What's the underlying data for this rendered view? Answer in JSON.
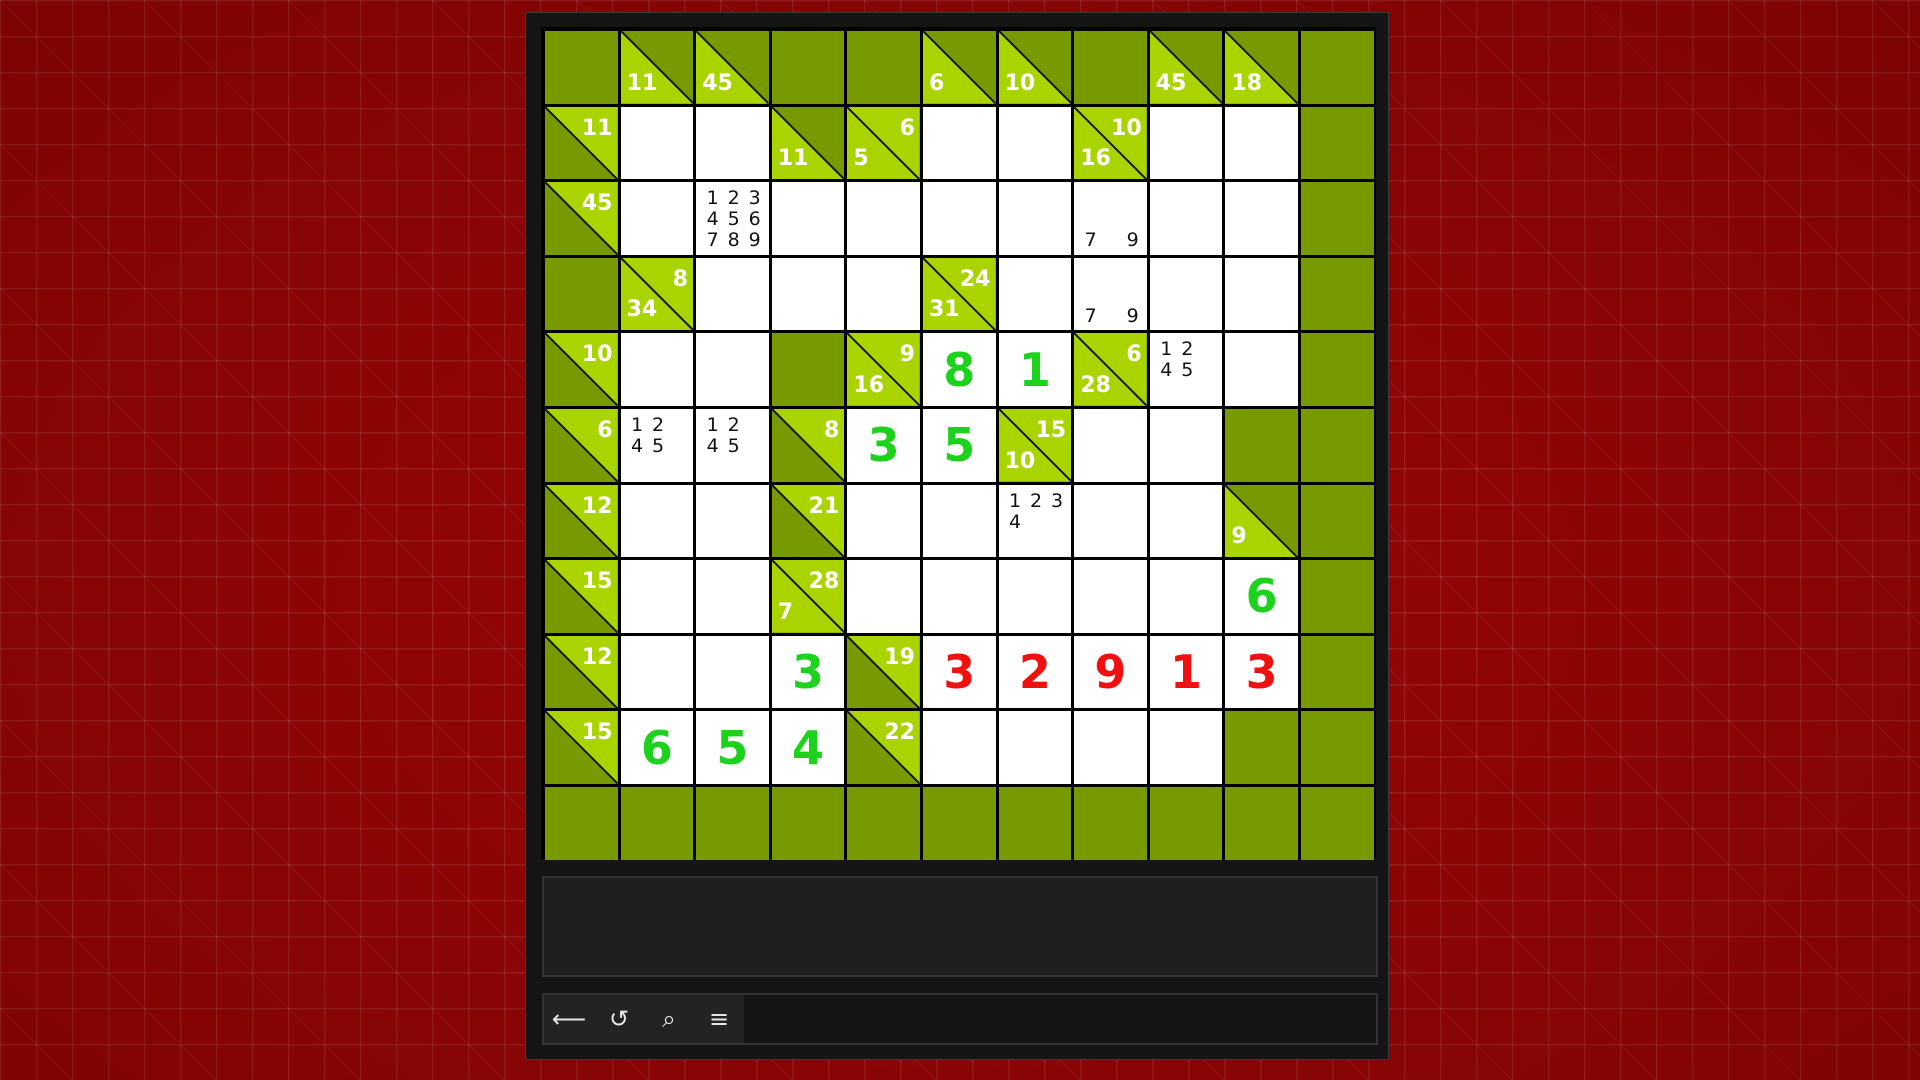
{
  "toolbar": {
    "buttons": [
      {
        "icon": "back-arrow-icon",
        "glyph": "⟵"
      },
      {
        "icon": "undo-icon",
        "glyph": "↺"
      },
      {
        "icon": "search-icon",
        "glyph": "⌕"
      },
      {
        "icon": "menu-icon",
        "glyph": "≡"
      }
    ]
  },
  "colors": {
    "block": "#779a00",
    "clue": "#aad400",
    "empty": "#ffffff",
    "correct": "#1cd21c",
    "wrong": "#f01010",
    "background": "#9a0606"
  },
  "grid": [
    [
      {
        "t": "b"
      },
      {
        "t": "c",
        "down": "11"
      },
      {
        "t": "c",
        "down": "45"
      },
      {
        "t": "b"
      },
      {
        "t": "b"
      },
      {
        "t": "c",
        "down": "6"
      },
      {
        "t": "c",
        "down": "10"
      },
      {
        "t": "b"
      },
      {
        "t": "c",
        "down": "45"
      },
      {
        "t": "c",
        "down": "18"
      },
      {
        "t": "b"
      }
    ],
    [
      {
        "t": "c",
        "right": "11"
      },
      {
        "t": "e"
      },
      {
        "t": "e"
      },
      {
        "t": "c",
        "down": "11"
      },
      {
        "t": "c",
        "right": "6",
        "down": "5"
      },
      {
        "t": "e"
      },
      {
        "t": "e"
      },
      {
        "t": "c",
        "right": "10",
        "down": "16"
      },
      {
        "t": "e"
      },
      {
        "t": "e"
      },
      {
        "t": "b"
      }
    ],
    [
      {
        "t": "c",
        "right": "45"
      },
      {
        "t": "e"
      },
      {
        "t": "e",
        "c": [
          "1",
          "2",
          "3",
          "4",
          "5",
          "6",
          "7",
          "8",
          "9"
        ]
      },
      {
        "t": "e"
      },
      {
        "t": "e"
      },
      {
        "t": "e"
      },
      {
        "t": "e"
      },
      {
        "t": "e",
        "c": [
          "",
          "",
          "",
          "",
          "",
          "",
          "7",
          "",
          "9"
        ]
      },
      {
        "t": "e"
      },
      {
        "t": "e"
      },
      {
        "t": "b"
      }
    ],
    [
      {
        "t": "b"
      },
      {
        "t": "c",
        "right": "8",
        "down": "34"
      },
      {
        "t": "e"
      },
      {
        "t": "e"
      },
      {
        "t": "e"
      },
      {
        "t": "c",
        "right": "24",
        "down": "31"
      },
      {
        "t": "e"
      },
      {
        "t": "e",
        "c": [
          "",
          "",
          "",
          "",
          "",
          "",
          "7",
          "",
          "9"
        ]
      },
      {
        "t": "e"
      },
      {
        "t": "e"
      },
      {
        "t": "b"
      }
    ],
    [
      {
        "t": "c",
        "right": "10"
      },
      {
        "t": "e"
      },
      {
        "t": "e"
      },
      {
        "t": "b"
      },
      {
        "t": "c",
        "right": "9",
        "down": "16"
      },
      {
        "t": "e",
        "v": "8",
        "s": "good"
      },
      {
        "t": "e",
        "v": "1",
        "s": "good"
      },
      {
        "t": "c",
        "right": "6",
        "down": "28"
      },
      {
        "t": "e",
        "c": [
          "1",
          "2",
          "",
          "4",
          "5",
          "",
          "",
          "",
          ""
        ]
      },
      {
        "t": "e"
      },
      {
        "t": "b"
      }
    ],
    [
      {
        "t": "c",
        "right": "6"
      },
      {
        "t": "e",
        "c": [
          "1",
          "2",
          "",
          "4",
          "5",
          "",
          "",
          "",
          ""
        ]
      },
      {
        "t": "e",
        "c": [
          "1",
          "2",
          "",
          "4",
          "5",
          "",
          "",
          "",
          ""
        ]
      },
      {
        "t": "c",
        "right": "8"
      },
      {
        "t": "e",
        "v": "3",
        "s": "good"
      },
      {
        "t": "e",
        "v": "5",
        "s": "good"
      },
      {
        "t": "c",
        "right": "15",
        "down": "10"
      },
      {
        "t": "e"
      },
      {
        "t": "e"
      },
      {
        "t": "b"
      },
      {
        "t": "b"
      }
    ],
    [
      {
        "t": "c",
        "right": "12"
      },
      {
        "t": "e"
      },
      {
        "t": "e"
      },
      {
        "t": "c",
        "right": "21"
      },
      {
        "t": "e"
      },
      {
        "t": "e"
      },
      {
        "t": "e",
        "c": [
          "1",
          "2",
          "3",
          "4",
          "",
          "",
          "",
          "",
          ""
        ]
      },
      {
        "t": "e"
      },
      {
        "t": "e"
      },
      {
        "t": "c",
        "down": "9"
      },
      {
        "t": "b"
      }
    ],
    [
      {
        "t": "c",
        "right": "15"
      },
      {
        "t": "e"
      },
      {
        "t": "e"
      },
      {
        "t": "c",
        "right": "28",
        "down": "7"
      },
      {
        "t": "e"
      },
      {
        "t": "e"
      },
      {
        "t": "e"
      },
      {
        "t": "e"
      },
      {
        "t": "e"
      },
      {
        "t": "e",
        "v": "6",
        "s": "good"
      },
      {
        "t": "b"
      }
    ],
    [
      {
        "t": "c",
        "right": "12"
      },
      {
        "t": "e"
      },
      {
        "t": "e"
      },
      {
        "t": "e",
        "v": "3",
        "s": "good"
      },
      {
        "t": "c",
        "right": "19"
      },
      {
        "t": "e",
        "v": "3",
        "s": "bad"
      },
      {
        "t": "e",
        "v": "2",
        "s": "bad"
      },
      {
        "t": "e",
        "v": "9",
        "s": "bad"
      },
      {
        "t": "e",
        "v": "1",
        "s": "bad"
      },
      {
        "t": "e",
        "v": "3",
        "s": "bad"
      },
      {
        "t": "b"
      }
    ],
    [
      {
        "t": "c",
        "right": "15"
      },
      {
        "t": "e",
        "v": "6",
        "s": "good"
      },
      {
        "t": "e",
        "v": "5",
        "s": "good"
      },
      {
        "t": "e",
        "v": "4",
        "s": "good"
      },
      {
        "t": "c",
        "right": "22"
      },
      {
        "t": "e"
      },
      {
        "t": "e"
      },
      {
        "t": "e"
      },
      {
        "t": "e"
      },
      {
        "t": "b"
      },
      {
        "t": "b"
      }
    ],
    [
      {
        "t": "b"
      },
      {
        "t": "b"
      },
      {
        "t": "b"
      },
      {
        "t": "b"
      },
      {
        "t": "b"
      },
      {
        "t": "b"
      },
      {
        "t": "b"
      },
      {
        "t": "b"
      },
      {
        "t": "b"
      },
      {
        "t": "b"
      },
      {
        "t": "b"
      }
    ]
  ]
}
